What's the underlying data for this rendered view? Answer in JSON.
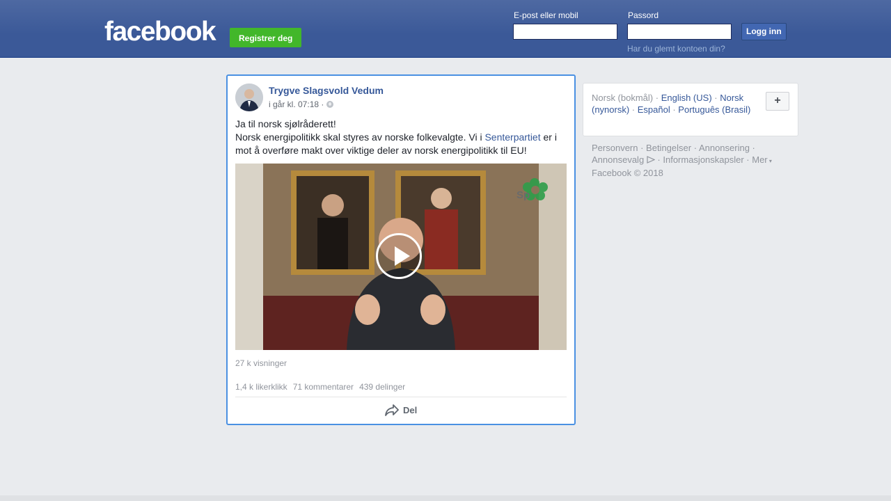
{
  "header": {
    "logo": "facebook",
    "register_label": "Registrer deg",
    "email_label": "E-post eller mobil",
    "password_label": "Passord",
    "login_label": "Logg inn",
    "forgot_label": "Har du glemt kontoen din?",
    "email_value": "",
    "password_value": ""
  },
  "post": {
    "author": "Trygve Slagsvold Vedum",
    "time": "i går kl. 07:18 ·",
    "text_line1": "Ja til norsk sjølråderett!",
    "text_line2_a": "Norsk energipolitikk skal styres av norske folkevalgte. Vi i",
    "text_link": "Senterpartiet",
    "text_line2_b": "er i mot å overføre makt over viktige deler av norsk energipolitikk til EU!",
    "video_logo": "Sp",
    "views": "27 k visninger",
    "likes": "1,4 k likerklikk",
    "comments": "71 kommentarer",
    "shares": "439 delinger",
    "share_label": "Del"
  },
  "languages": {
    "current": "Norsk (bokmål)",
    "others": [
      "English (US)",
      "Norsk (nynorsk)",
      "Español",
      "Português (Brasil)"
    ],
    "add_label": "+"
  },
  "footer": {
    "links": [
      "Personvern",
      "Betingelser",
      "Annonsering",
      "Annonsevalg",
      "Informasjonskapsler",
      "Mer"
    ],
    "copyright": "Facebook © 2018"
  },
  "colors": {
    "brand": "#3b5998",
    "register": "#42b72a",
    "link": "#365899",
    "background": "#e9ebee"
  }
}
